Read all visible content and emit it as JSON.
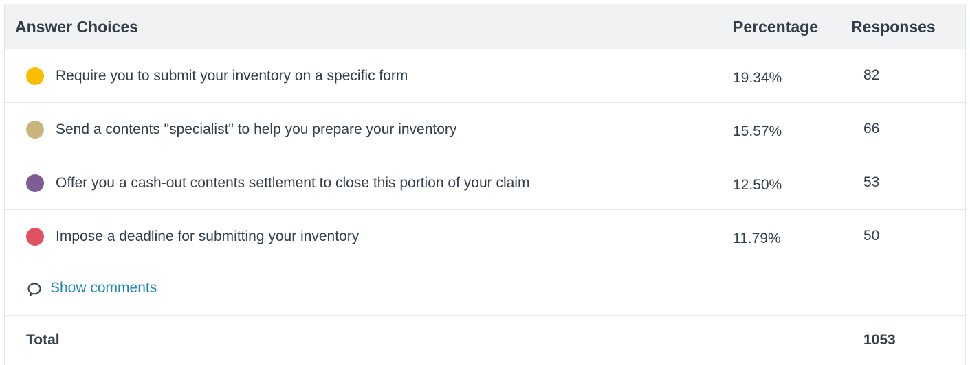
{
  "header": {
    "answer_choices": "Answer Choices",
    "percentage": "Percentage",
    "responses": "Responses"
  },
  "rows": [
    {
      "label": "Require you to submit your inventory on a specific form",
      "percentage": "19.34%",
      "responses": "82",
      "color": "#f9be00"
    },
    {
      "label": "Send a contents \"specialist\" to help you prepare your inventory",
      "percentage": "15.57%",
      "responses": "66",
      "color": "#c9b57c"
    },
    {
      "label": "Offer you a cash-out contents settlement to close this portion of your claim",
      "percentage": "12.50%",
      "responses": "53",
      "color": "#7d5d94"
    },
    {
      "label": "Impose a deadline for submitting your inventory",
      "percentage": "11.79%",
      "responses": "50",
      "color": "#e05263"
    }
  ],
  "comments": {
    "label": "Show comments",
    "icon": "comment-bubble-icon"
  },
  "total": {
    "label": "Total",
    "value": "1053"
  },
  "colors": {
    "header_bg": "#f1f2f3",
    "link": "#1e87b9",
    "text": "#333e48",
    "border": "#e4e6e8"
  }
}
